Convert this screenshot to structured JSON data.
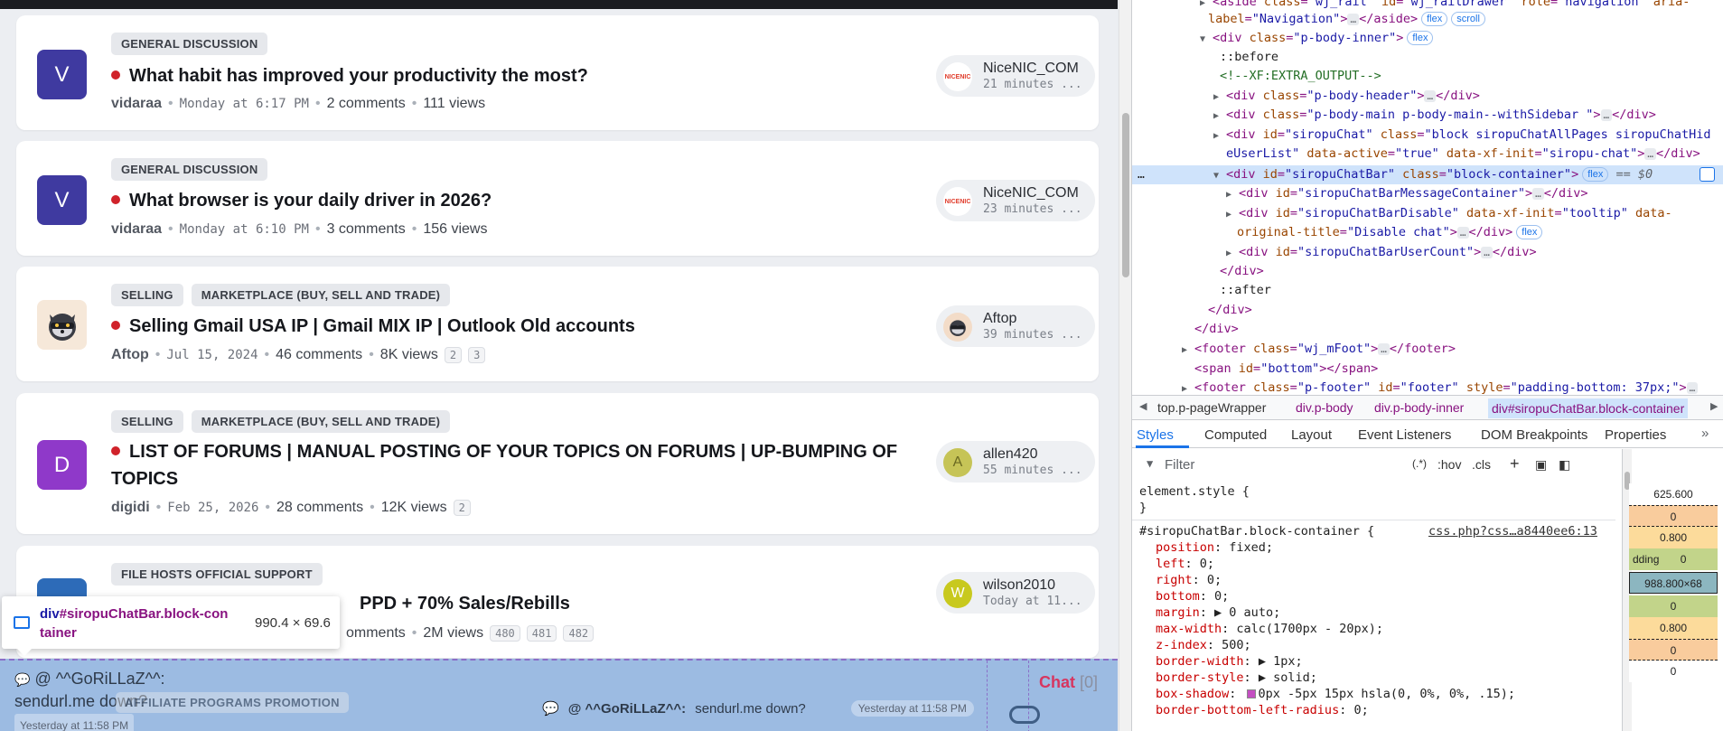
{
  "threads": [
    {
      "avatar_letter": "V",
      "tags": [
        "GENERAL DISCUSSION"
      ],
      "title": "What habit has improved your productivity the most?",
      "author": "vidaraa",
      "date": "Monday at 6:17 PM",
      "comments": "2 comments",
      "views": "111 views",
      "pages": [],
      "last_user": "NiceNIC_COM",
      "last_time": "21 minutes ..."
    },
    {
      "avatar_letter": "V",
      "tags": [
        "GENERAL DISCUSSION"
      ],
      "title": "What browser is your daily driver in 2026?",
      "author": "vidaraa",
      "date": "Monday at 6:10 PM",
      "comments": "3 comments",
      "views": "156 views",
      "pages": [],
      "last_user": "NiceNIC_COM",
      "last_time": "23 minutes ..."
    },
    {
      "avatar_letter": "",
      "tags": [
        "SELLING",
        "MARKETPLACE (BUY, SELL AND TRADE)"
      ],
      "title": "Selling Gmail USA IP | Gmail MIX IP | Outlook Old accounts",
      "author": "Aftop",
      "date": "Jul 15, 2024",
      "comments": "46 comments",
      "views": "8K views",
      "pages": [
        "2",
        "3"
      ],
      "last_user": "Aftop",
      "last_time": "39 minutes ..."
    },
    {
      "avatar_letter": "D",
      "tags": [
        "SELLING",
        "MARKETPLACE (BUY, SELL AND TRADE)"
      ],
      "title": "LIST OF FORUMS | MANUAL POSTING OF YOUR TOPICS ON FORUMS | UP-BUMPING OF TOPICS",
      "author": "digidi",
      "date": "Feb 25, 2026",
      "comments": "28 comments",
      "views": "12K views",
      "pages": [
        "2"
      ],
      "last_user": "allen420",
      "last_user_initial": "A",
      "last_time": "55 minutes ..."
    },
    {
      "avatar_letter": "",
      "tags": [
        "FILE HOSTS OFFICIAL SUPPORT"
      ],
      "title": "PPD + 70% Sales/Rebills",
      "author": "",
      "date": "",
      "comments": "omments",
      "views": "2M views",
      "pages": [
        "480",
        "481",
        "482"
      ],
      "last_user": "wilson2010",
      "last_user_initial": "W",
      "last_time": "Today at 11..."
    }
  ],
  "nicenic_logo": "NICENIC",
  "inspector_tip": {
    "tag": "div",
    "id": "#siropuChatBar.block-con",
    "id2": "tainer",
    "size": "990.4 × 69.6"
  },
  "chatbar": {
    "left_user": "@ ^^GoRiLLaZ^^:",
    "left_msg": "sendurl.me down?",
    "left_time": "Yesterday at 11:58 PM",
    "ghost_tag": "AFFILIATE PROGRAMS PROMOTION",
    "mid_user": "@ ^^GoRiLLaZ^^:",
    "mid_msg": "sendurl.me down?",
    "mid_time": "Yesterday at 11:58 PM",
    "label": "Chat",
    "count": "[0]"
  },
  "devtools": {
    "breadcrumbs": [
      "top.p-pageWrapper",
      "div.p-body",
      "div.p-body-inner",
      "div#siropuChatBar.block-container"
    ],
    "tabs": [
      "Styles",
      "Computed",
      "Layout",
      "Event Listeners",
      "DOM Breakpoints",
      "Properties"
    ],
    "filter_placeholder": "Filter",
    "filter_tools": [
      ":hov",
      ".cls"
    ],
    "element_style": "element.style {",
    "rule_selector": "#siropuChatBar.block-container {",
    "rule_source": "css.php?css…a8440ee6:13",
    "declarations": [
      {
        "p": "position",
        "v": "fixed;"
      },
      {
        "p": "left",
        "v": "0;"
      },
      {
        "p": "right",
        "v": "0;"
      },
      {
        "p": "bottom",
        "v": "0;"
      },
      {
        "p": "margin",
        "v": "▶ 0 auto;"
      },
      {
        "p": "max-width",
        "v": "calc(1700px - 20px);"
      },
      {
        "p": "z-index",
        "v": "500;"
      },
      {
        "p": "border-width",
        "v": "▶ 1px;"
      },
      {
        "p": "border-style",
        "v": "▶ solid;"
      },
      {
        "p": "box-shadow",
        "v": "0px -5px 15px hsla(0, 0%, 0%, .15);"
      },
      {
        "p": "border-bottom-left-radius",
        "v": "0;"
      }
    ],
    "boxmodel": [
      "625.600",
      "0",
      "0.800",
      "dding",
      "0",
      "988.800×68",
      "0",
      "0.800",
      "0",
      "0"
    ]
  }
}
